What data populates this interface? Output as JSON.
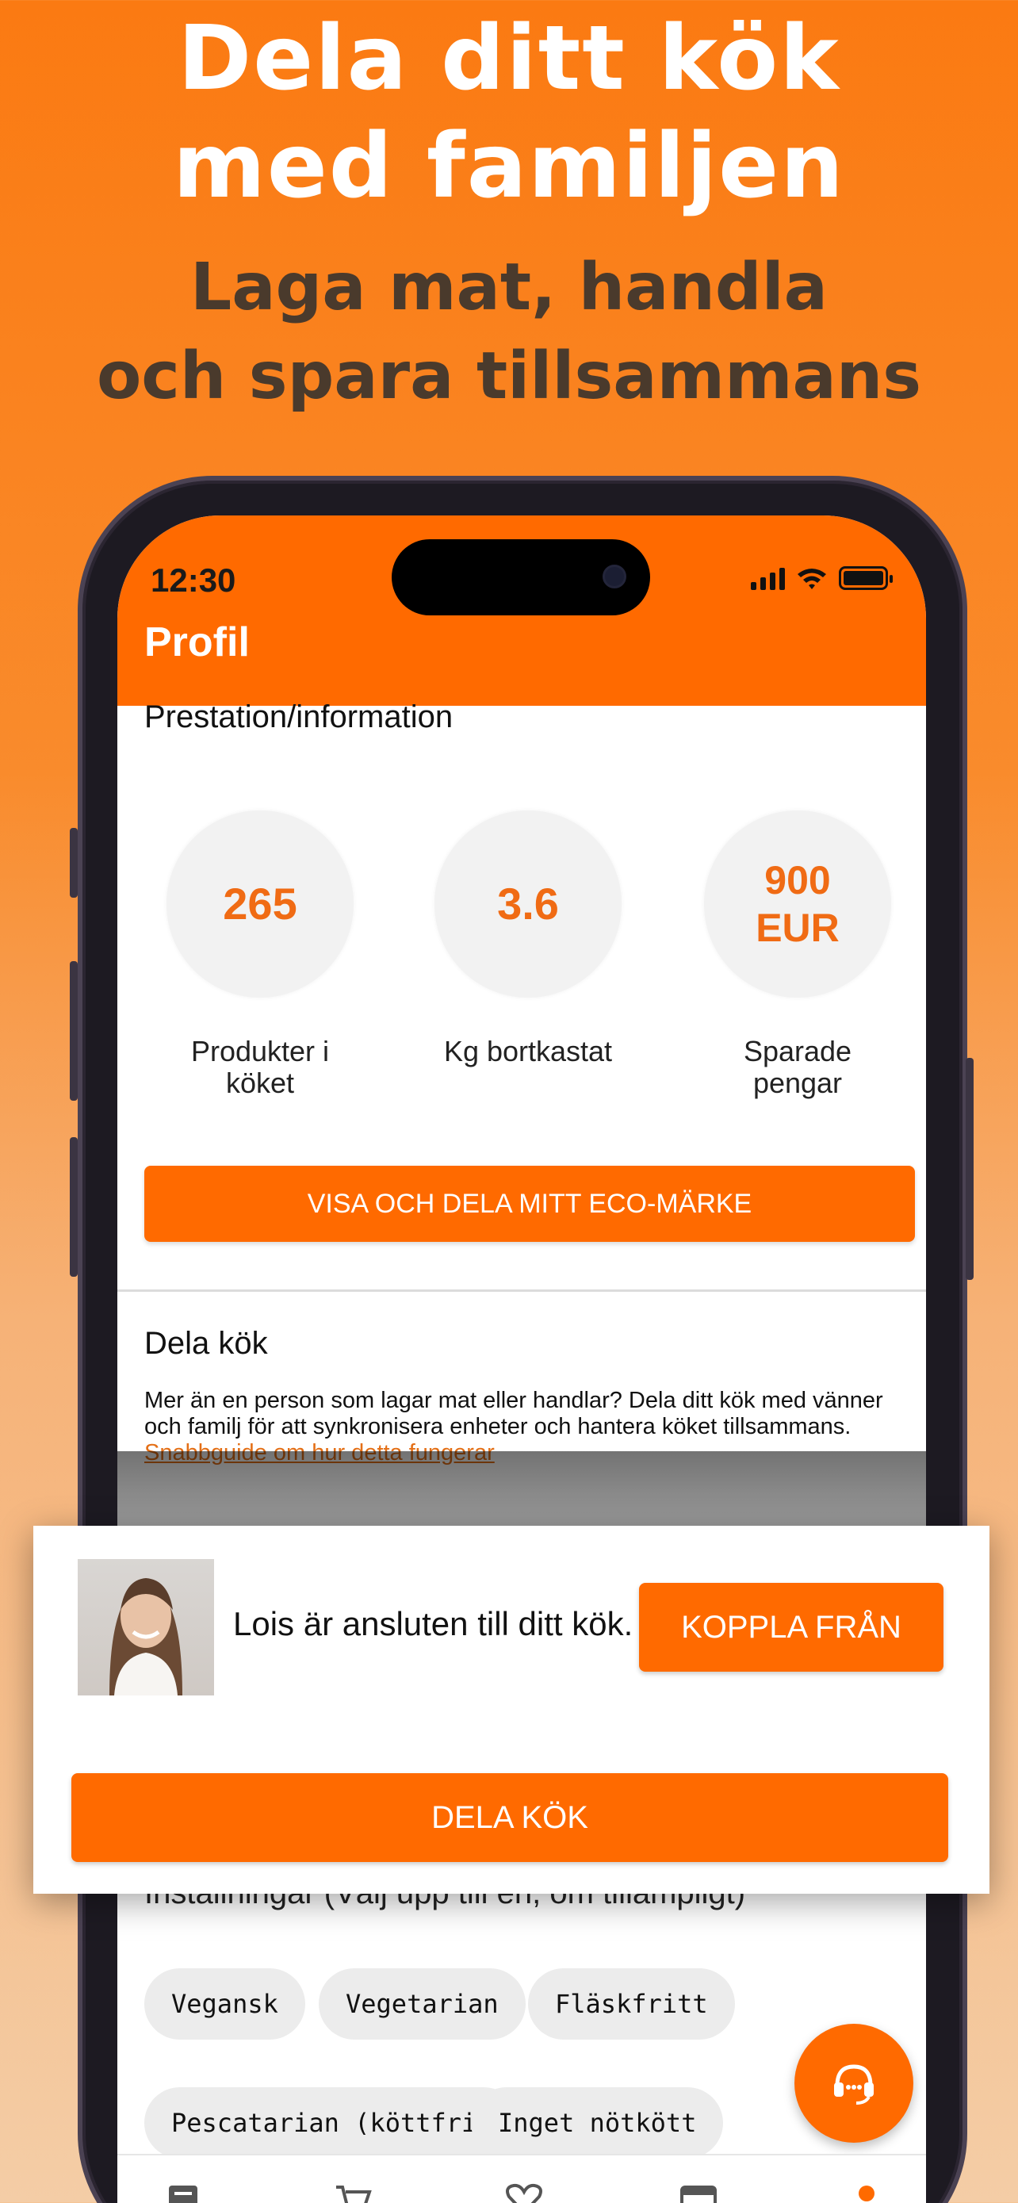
{
  "promo": {
    "headline_line1": "Dela ditt kök",
    "headline_line2": "med familjen",
    "subline_line1": "Laga mat, handla",
    "subline_line2": "och spara tillsammans"
  },
  "status_bar": {
    "time": "12:30"
  },
  "app_bar": {
    "title": "Profil"
  },
  "achievements": {
    "section_title": "Prestation/information",
    "stats": [
      {
        "value": "265",
        "label_line1": "Produkter i",
        "label_line2": "köket"
      },
      {
        "value": "3.6",
        "label_line1": "Kg bortkastat",
        "label_line2": ""
      },
      {
        "value_line1": "900",
        "value_line2": "EUR",
        "label_line1": "Sparade",
        "label_line2": "pengar"
      }
    ],
    "eco_button": "VISA OCH DELA MITT ECO-MÄRKE"
  },
  "share_kitchen": {
    "title": "Dela kök",
    "description": "Mer än en person som lagar mat eller handlar? Dela ditt kök med vänner och familj för att synkronisera enheter och hantera köket tillsammans. ",
    "guide_link": "Snabbguide om hur detta fungerar"
  },
  "preferences": {
    "title": "Inställningar (Välj upp till en, om tillämpligt)",
    "chips": [
      "Vegansk",
      "Vegetarian",
      "Fläskfritt",
      "Pescatarian (köttfri)",
      "Inget nötkött"
    ]
  },
  "overlay": {
    "member_text": "Lois är ansluten till ditt kök.",
    "disconnect_button": "KOPPLA FRÅN",
    "share_button": "DELA KÖK"
  },
  "bottom_nav": {
    "icons": [
      "inventory-icon",
      "cart-icon",
      "heart-icon",
      "calendar-icon",
      "profile-dot-icon"
    ]
  },
  "colors": {
    "brand_orange": "#ff6a00",
    "stat_value": "#f06b14",
    "link": "#e46f16"
  }
}
